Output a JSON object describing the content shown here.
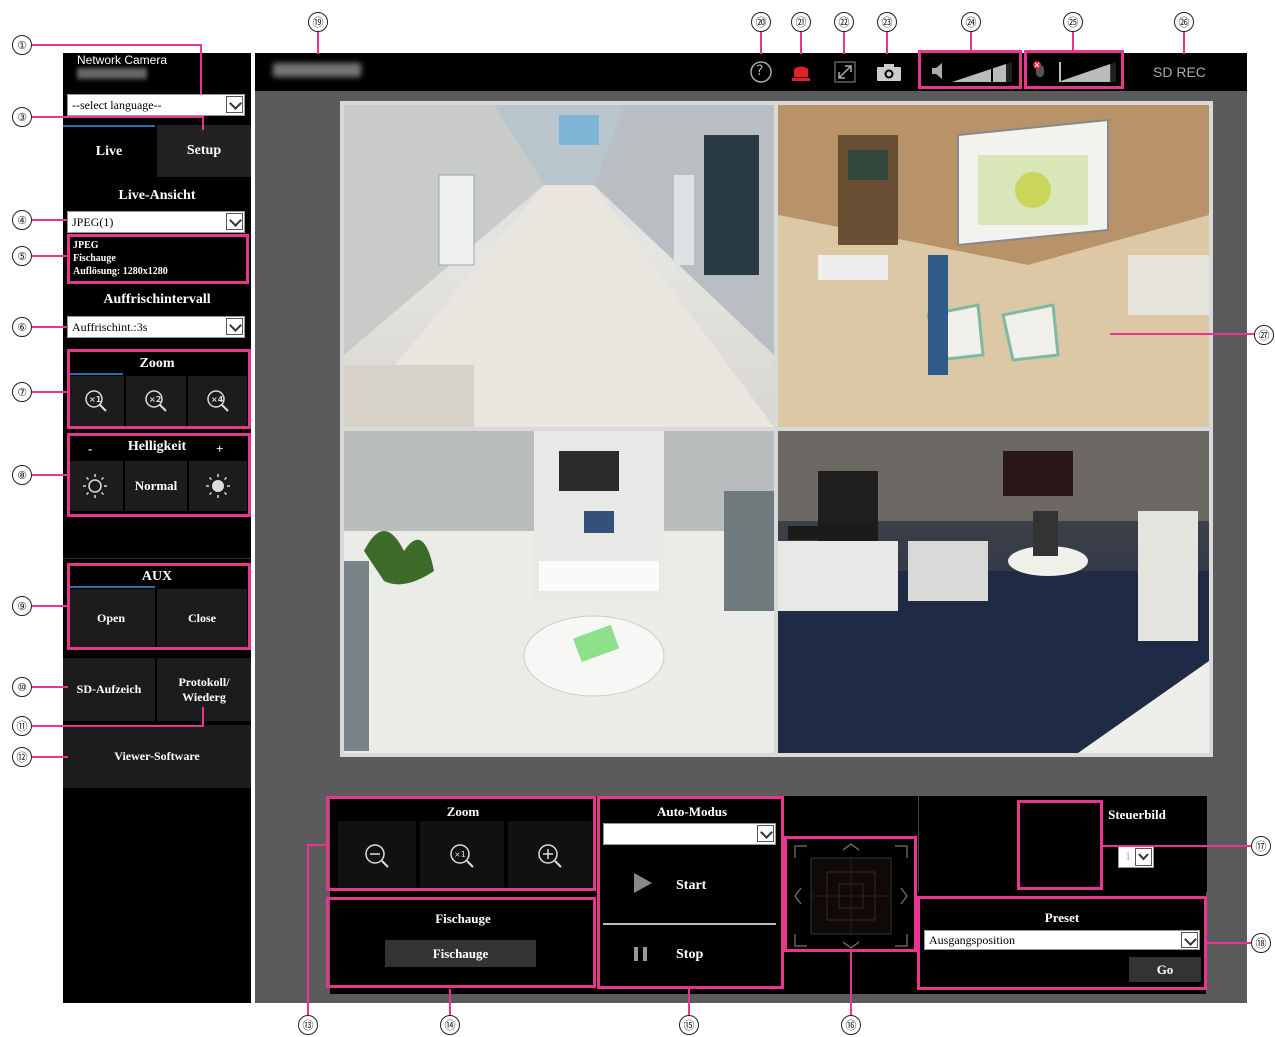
{
  "sidebar": {
    "product_label": "Network Camera",
    "language": {
      "value": "--select language--"
    },
    "tabs": [
      {
        "label": "Live"
      },
      {
        "label": "Setup"
      }
    ],
    "live_view": {
      "title": "Live-Ansicht",
      "stream": "JPEG(1)",
      "info_lines": [
        "JPEG",
        "Fischauge",
        "Auflösung: 1280x1280"
      ]
    },
    "refresh": {
      "title": "Auffrischintervall",
      "value": "Auffrischint.:3s"
    },
    "zoom": {
      "title": "Zoom",
      "buttons": [
        "×1",
        "×2",
        "×4"
      ]
    },
    "brightness": {
      "title": "Helligkeit",
      "minus": "-",
      "plus": "+",
      "normal": "Normal"
    },
    "aux": {
      "title": "AUX",
      "open": "Open",
      "close": "Close"
    },
    "sd_button": "SD-Aufzeich",
    "log_button_line1": "Protokoll/",
    "log_button_line2": "Wiederg",
    "viewer_button": "Viewer-Software"
  },
  "header": {
    "help_glyph": "?",
    "sd_rec": "SD REC",
    "volume_level": 0.9,
    "mic_level": 0.9
  },
  "controls": {
    "zoom_title": "Zoom",
    "auto_mode_title": "Auto-Modus",
    "auto_mode_value": "",
    "start_label": "Start",
    "stop_label": "Stop",
    "fisheye_title": "Fischauge",
    "fisheye_button": "Fischauge",
    "control_image_title": "Steuerbild",
    "control_image_value": "1",
    "preset_title": "Preset",
    "preset_value": "Ausgangsposition",
    "go_label": "Go"
  },
  "callouts": [
    "①",
    "③",
    "④",
    "⑤",
    "⑥",
    "⑦",
    "⑧",
    "⑨",
    "⑩",
    "⑪",
    "⑫",
    "⑬",
    "⑭",
    "⑮",
    "⑯",
    "⑰",
    "⑱",
    "⑲",
    "⑳",
    "㉑",
    "㉒",
    "㉓",
    "㉔",
    "㉕",
    "㉖",
    "㉗"
  ],
  "colors": {
    "accent": "#e8358f",
    "tab_blue": "#2f6ea8",
    "panel_bg": "#000000",
    "main_bg": "#5b5b5b"
  }
}
